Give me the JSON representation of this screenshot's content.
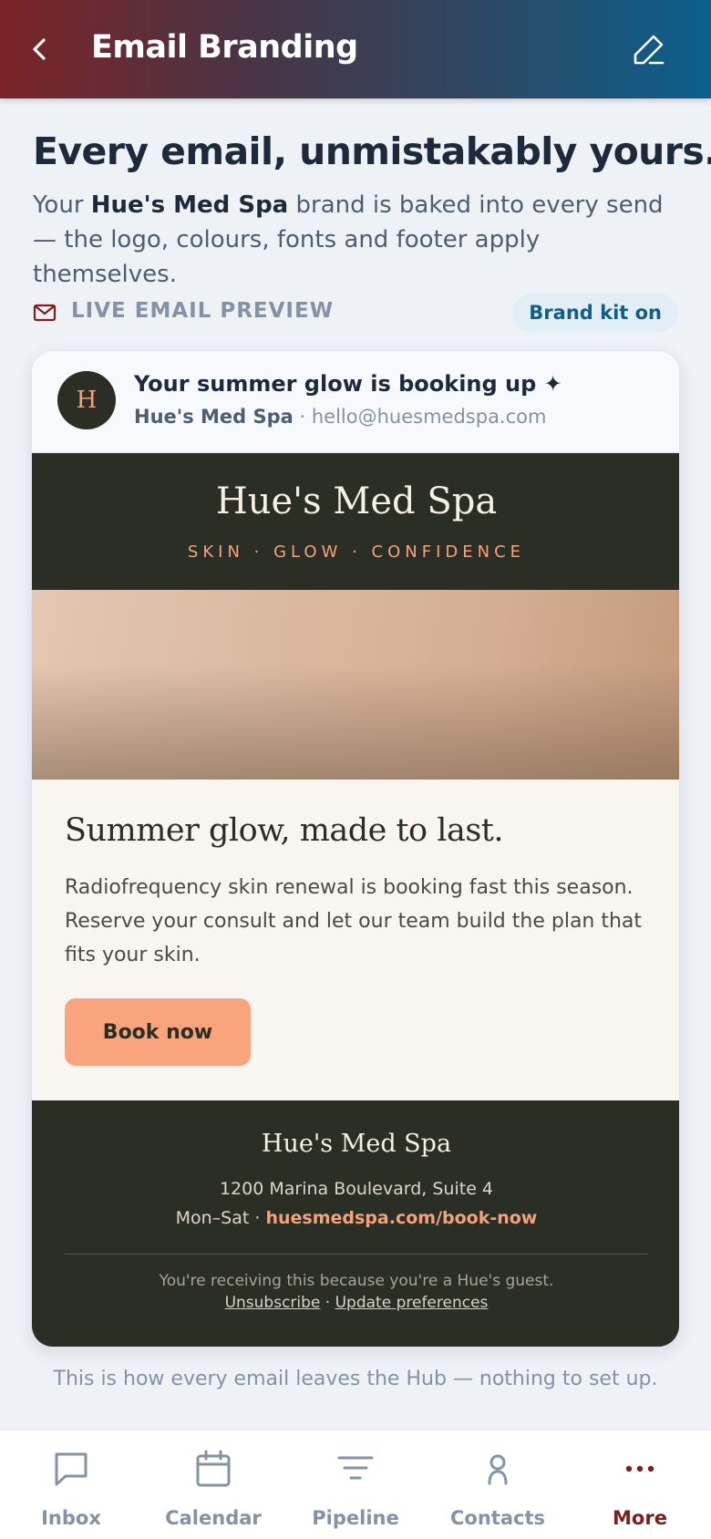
{
  "header": {
    "title": "Email Branding",
    "back_icon": "chevron-left-icon",
    "edit_icon": "pencil-icon"
  },
  "hero": {
    "title": "Every email, unmistakably yours.",
    "subtitle_pre": "Your ",
    "subtitle_brand": "Hue's Med Spa",
    "subtitle_post": " brand is baked into every send — the logo, colours, fonts and footer apply themselves."
  },
  "preview_section": {
    "label": "LIVE EMAIL PREVIEW",
    "badge": "Brand kit on"
  },
  "email": {
    "avatar_letter": "H",
    "subject": "Your summer glow is booking up ✦",
    "sender_name": "Hue's Med Spa",
    "sender_separator": " · ",
    "sender_email": "hello@huesmedspa.com",
    "banner_name": "Hue's Med Spa",
    "banner_tagline": "SKIN · GLOW · CONFIDENCE",
    "body_title": "Summer glow, made to last.",
    "body_text": "Radiofrequency skin renewal is booking fast this season. Reserve your consult and let our team build the plan that fits your skin.",
    "cta_label": "Book now",
    "footer": {
      "name": "Hue's Med Spa",
      "address": "1200 Marina Boulevard, Suite 4",
      "hours": "Mon–Sat · ",
      "link": "huesmedspa.com/book-now",
      "note": "You're receiving this because you're a Hue's guest.",
      "unsubscribe": "Unsubscribe",
      "links_separator": " · ",
      "preferences": "Update preferences"
    }
  },
  "caption": "This is how every email leaves the Hub — nothing to set up.",
  "nav": [
    {
      "label": "Inbox",
      "icon": "chat-bubble-icon",
      "active": false
    },
    {
      "label": "Calendar",
      "icon": "calendar-icon",
      "active": false
    },
    {
      "label": "Pipeline",
      "icon": "filter-icon",
      "active": false
    },
    {
      "label": "Contacts",
      "icon": "person-icon",
      "active": false
    },
    {
      "label": "More",
      "icon": "more-dots-icon",
      "active": true
    }
  ],
  "colors": {
    "header_gradient_start": "#7b2426",
    "header_gradient_end": "#0c5f8c",
    "brand_dark": "#2b2e24",
    "brand_peach": "#f9a47c",
    "nav_active": "#7b1f1f"
  }
}
